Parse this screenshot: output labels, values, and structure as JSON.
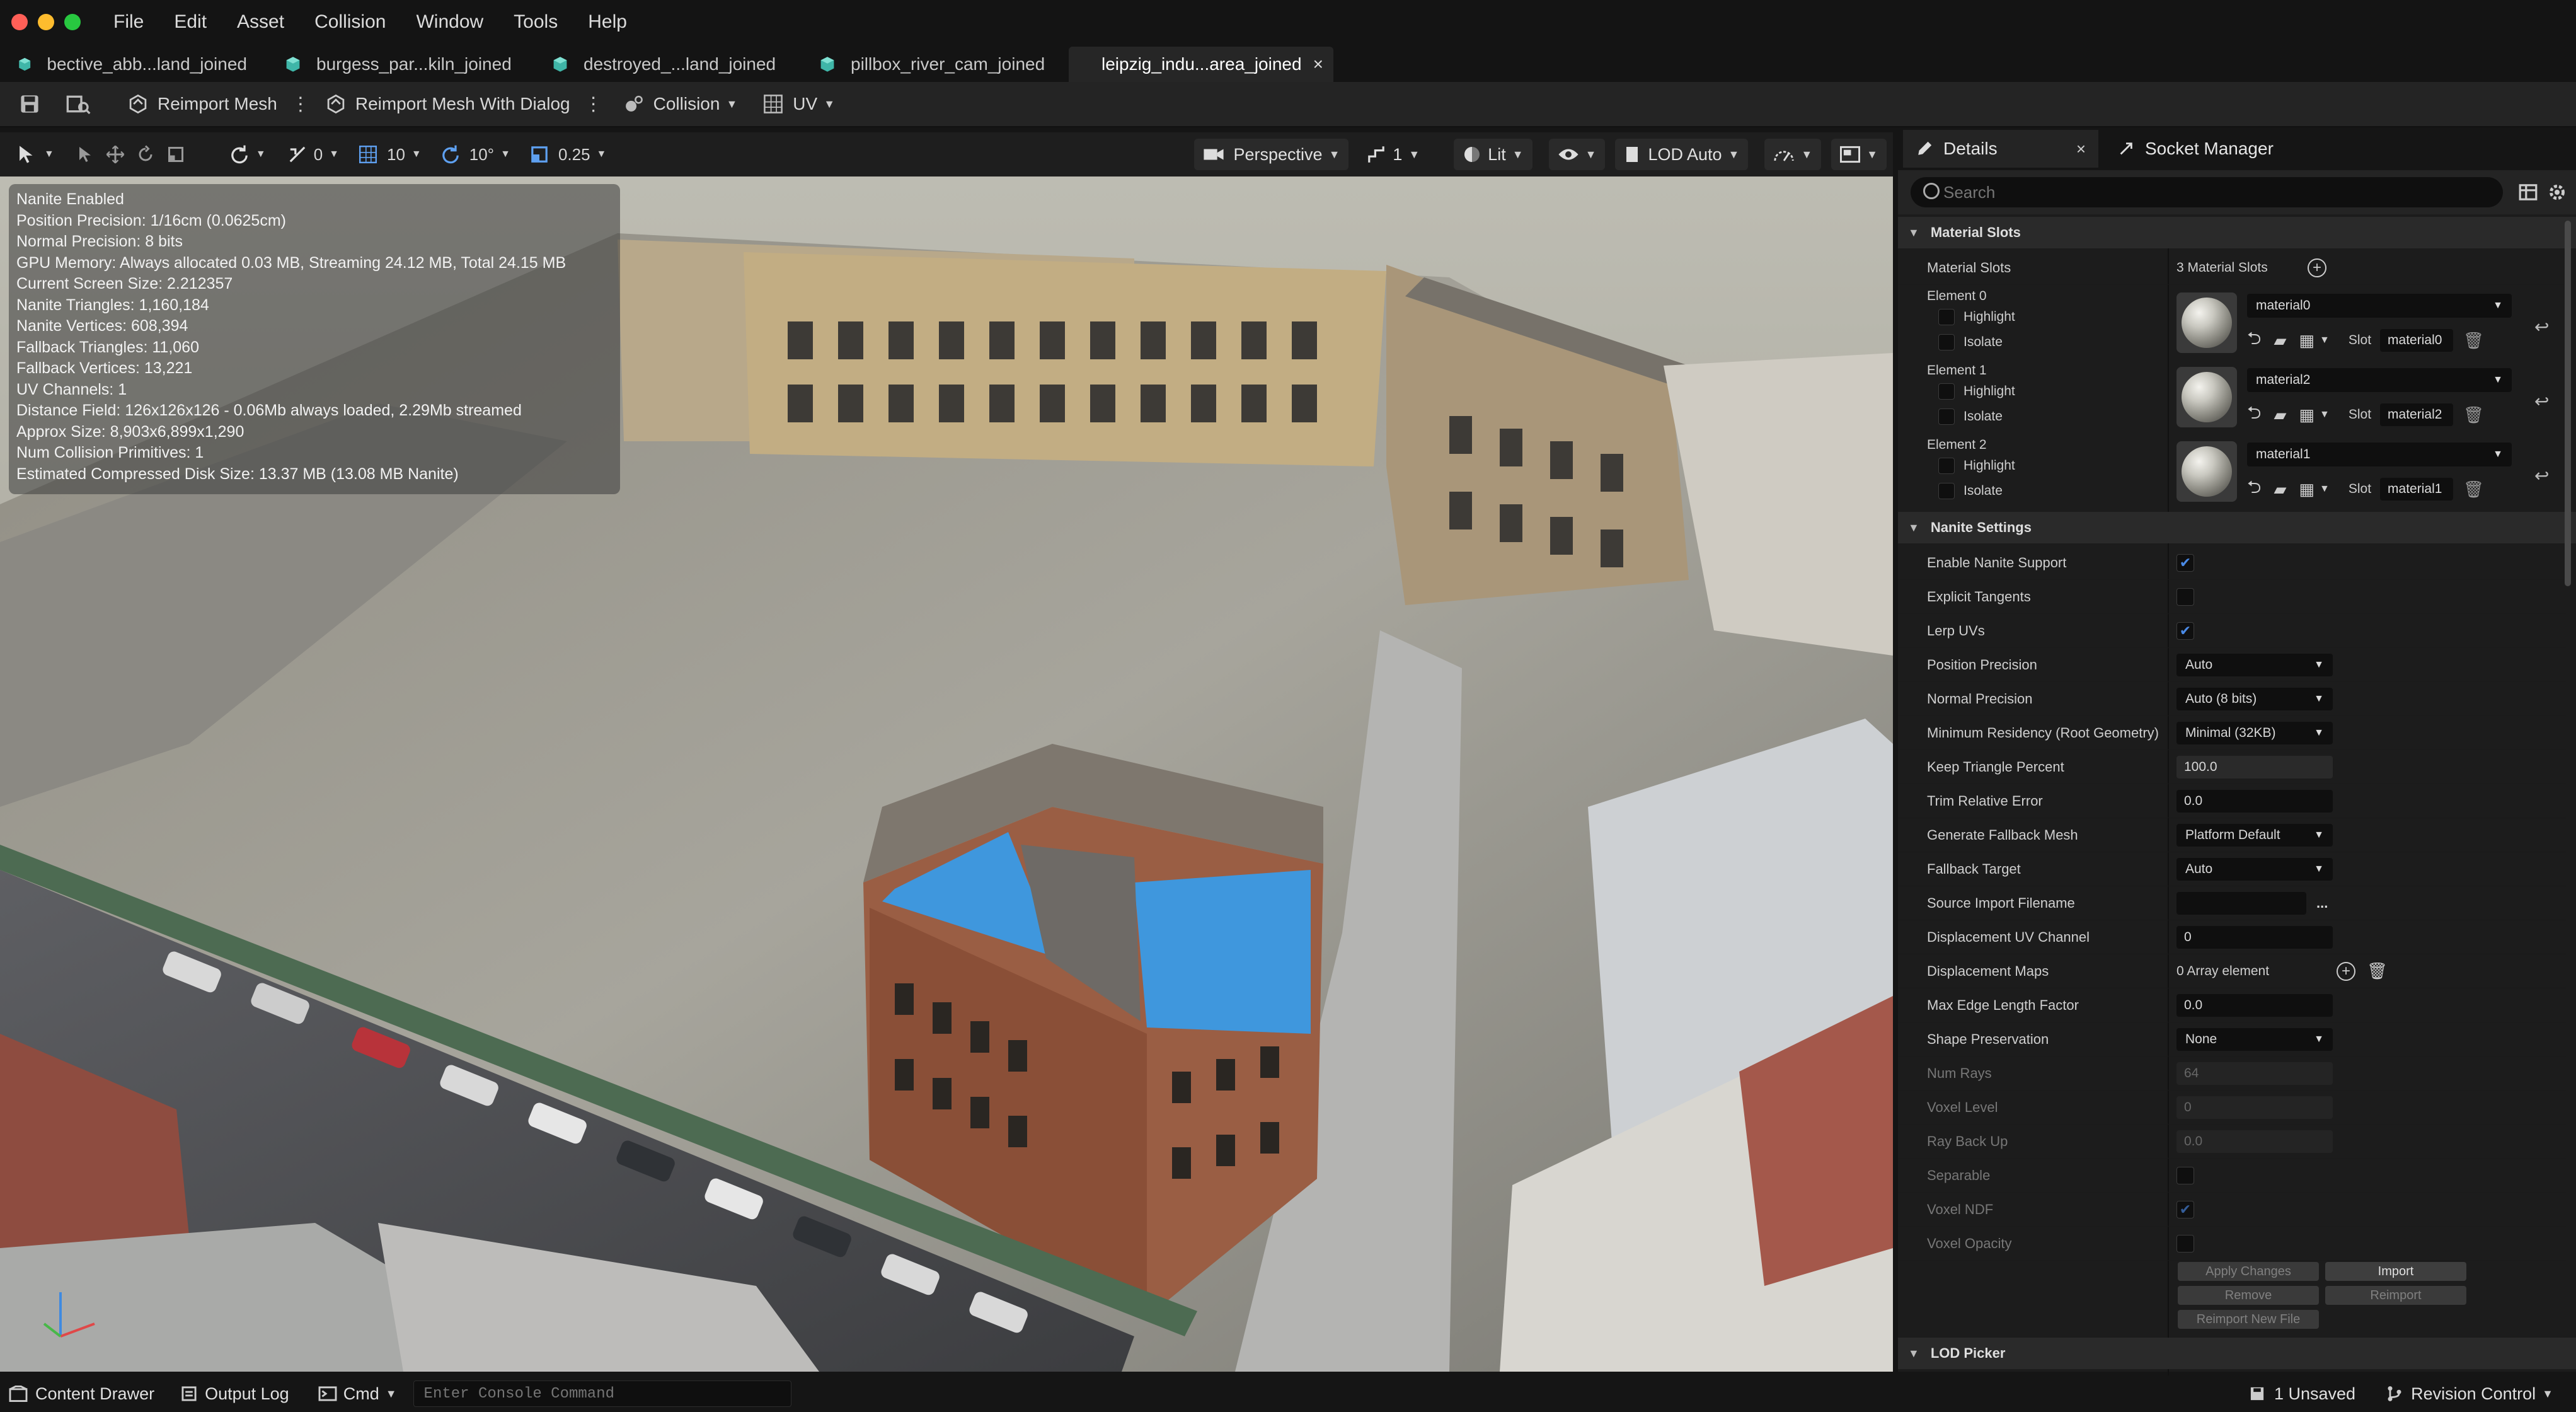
{
  "menu": {
    "items": [
      "File",
      "Edit",
      "Asset",
      "Collision",
      "Window",
      "Tools",
      "Help"
    ]
  },
  "tabs": [
    {
      "label": "bective_abb...land_joined",
      "active": false
    },
    {
      "label": "burgess_par...kiln_joined",
      "active": false
    },
    {
      "label": "destroyed_...land_joined",
      "active": false
    },
    {
      "label": "pillbox_river_cam_joined",
      "active": false
    },
    {
      "label": "leipzig_indu...area_joined",
      "active": true
    }
  ],
  "toolbar": {
    "reimport_mesh": "Reimport Mesh",
    "reimport_mesh_dialog": "Reimport Mesh With Dialog",
    "collision": "Collision",
    "uv": "UV"
  },
  "viewport_toolbar": {
    "rotate_snap_val": "0",
    "grid_snap_val": "10",
    "angle_snap_val": "10°",
    "scale_snap_val": "0.25",
    "perspective": "Perspective",
    "camera_speed": "1",
    "lit": "Lit",
    "lod": "LOD Auto"
  },
  "stats": [
    "Nanite Enabled",
    "Position Precision: 1/16cm (0.0625cm)",
    "Normal Precision: 8 bits",
    "GPU Memory: Always allocated 0.03 MB, Streaming 24.12 MB, Total 24.15 MB",
    "Current Screen Size:  2.212357",
    "Nanite Triangles:  1,160,184",
    "Nanite Vertices:  608,394",
    "Fallback Triangles:  11,060",
    "Fallback Vertices:  13,221",
    "UV Channels:  1",
    "Distance Field:  126x126x126 - 0.06Mb always loaded, 2.29Mb streamed",
    "Approx Size: 8,903x6,899x1,290",
    "Num Collision Primitives:  1",
    "Estimated Compressed Disk Size: 13.37 MB (13.08 MB Nanite)"
  ],
  "panel": {
    "details_tab": "Details",
    "socket_tab": "Socket Manager",
    "search_placeholder": "Search",
    "material_slots_section": "Material Slots",
    "material_slots_label": "Material Slots",
    "material_slots_value": "3 Material Slots",
    "highlight": "Highlight",
    "isolate": "Isolate",
    "slot_label": "Slot",
    "elements": [
      {
        "label": "Element 0",
        "material": "material0",
        "slot": "material0"
      },
      {
        "label": "Element 1",
        "material": "material2",
        "slot": "material2"
      },
      {
        "label": "Element 2",
        "material": "material1",
        "slot": "material1"
      }
    ],
    "nanite_section": "Nanite Settings",
    "nanite": {
      "enable_label": "Enable Nanite Support",
      "explicit_label": "Explicit Tangents",
      "lerp_label": "Lerp UVs",
      "pos_prec_label": "Position Precision",
      "pos_prec_val": "Auto",
      "norm_prec_label": "Normal Precision",
      "norm_prec_val": "Auto (8 bits)",
      "min_res_label": "Minimum Residency (Root Geometry)",
      "min_res_val": "Minimal (32KB)",
      "keep_tri_label": "Keep Triangle Percent",
      "keep_tri_val": "100.0",
      "trim_label": "Trim Relative Error",
      "trim_val": "0.0",
      "gen_fb_label": "Generate Fallback Mesh",
      "gen_fb_val": "Platform Default",
      "fb_target_label": "Fallback Target",
      "fb_target_val": "Auto",
      "src_import_label": "Source Import Filename",
      "src_import_more": "...",
      "disp_uv_label": "Displacement UV Channel",
      "disp_uv_val": "0",
      "disp_maps_label": "Displacement Maps",
      "disp_maps_val": "0 Array element",
      "max_edge_label": "Max Edge Length Factor",
      "max_edge_val": "0.0",
      "shape_label": "Shape Preservation",
      "shape_val": "None",
      "num_rays_label": "Num Rays",
      "num_rays_val": "64",
      "voxel_level_label": "Voxel Level",
      "voxel_level_val": "0",
      "ray_back_label": "Ray Back Up",
      "ray_back_val": "0.0",
      "separable_label": "Separable",
      "voxel_ndf_label": "Voxel NDF",
      "voxel_opacity_label": "Voxel Opacity"
    },
    "buttons": {
      "apply": "Apply Changes",
      "import": "Import",
      "remove": "Remove",
      "reimport": "Reimport",
      "reimport_new": "Reimport New File"
    },
    "lod_section": "LOD Picker"
  },
  "statusbar": {
    "content_drawer": "Content Drawer",
    "output_log": "Output Log",
    "cmd": "Cmd",
    "console_placeholder": "Enter Console Command",
    "unsaved": "1 Unsaved",
    "revision": "Revision Control"
  },
  "colors": {
    "accent_blue": "#4a8ae6",
    "bg_dark": "#151515",
    "panel_bg": "#1c1c1c"
  }
}
